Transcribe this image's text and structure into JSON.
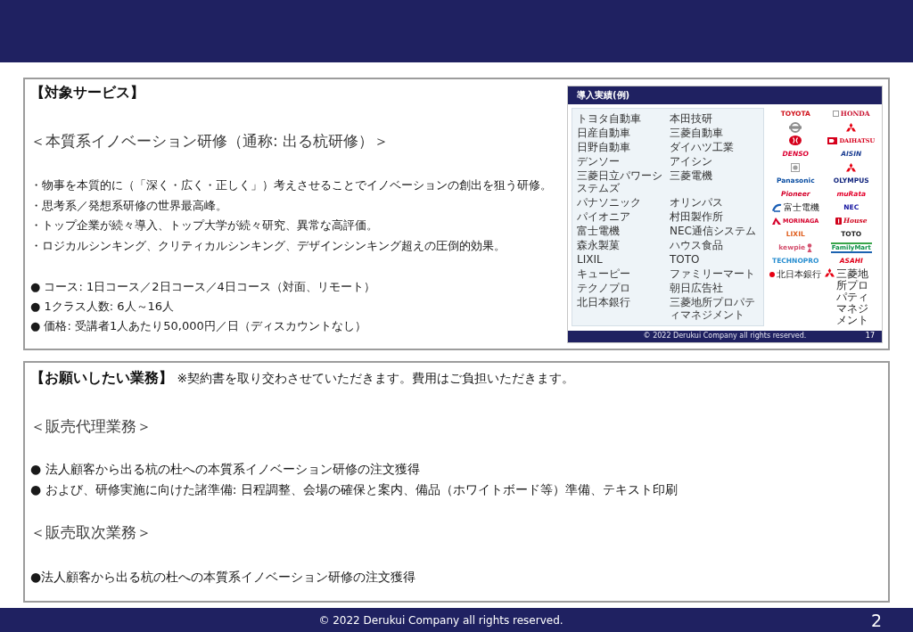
{
  "service_section": {
    "title": "【対象サービス】",
    "subtitle": "＜本質系イノベーション研修（通称: 出る杭研修）＞",
    "points": [
      "・物事を本質的に（「深く・広く・正しく」）考えさせることでイノベーションの創出を狙う研修。",
      "・思考系／発想系研修の世界最高峰。",
      "・トップ企業が続々導入、トップ大学が続々研究、異常な高評価。",
      "・ロジカルシンキング、クリティカルシンキング、デザインシンキング超えの圧倒的効果。"
    ],
    "details": [
      "● コース: 1日コース／2日コース／4日コース（対面、リモート）",
      "● 1クラス人数: 6人～16人",
      "● 価格: 受講者1人あたり50,000円／日（ディスカウントなし）"
    ],
    "slide": {
      "title": "導入実績(例)",
      "companies": [
        [
          "トヨタ自動車",
          "本田技研"
        ],
        [
          "日産自動車",
          "三菱自動車"
        ],
        [
          "日野自動車",
          "ダイハツ工業"
        ],
        [
          "デンソー",
          "アイシン"
        ],
        [
          "三菱日立パワーシステムズ",
          "三菱電機"
        ],
        [
          "パナソニック",
          "オリンパス"
        ],
        [
          "パイオニア",
          "村田製作所"
        ],
        [
          "富士電機",
          "NEC通信システム"
        ],
        [
          "森永製菓",
          "ハウス食品"
        ],
        [
          "LIXIL",
          "TOTO"
        ],
        [
          "キューピー",
          "ファミリーマート"
        ],
        [
          "テクノプロ",
          "朝日広告社"
        ],
        [
          "北日本銀行",
          "三菱地所プロパティマネジメント"
        ]
      ],
      "logos": [
        {
          "kind": "bold",
          "text": "TOYOTA",
          "color": "#d0121b"
        },
        {
          "kind": "serif",
          "text": "HONDA",
          "color": "#c8102e"
        },
        {
          "kind": "ring",
          "color": "#8c8c8c"
        },
        {
          "kind": "diamonds",
          "color": "#e60012"
        },
        {
          "kind": "oval",
          "color": "#d6001c"
        },
        {
          "kind": "tag",
          "text": "DAIHATSU",
          "color": "#d6001c"
        },
        {
          "kind": "italic",
          "text": "DENSO",
          "color": "#dc0032"
        },
        {
          "kind": "italic",
          "text": "AISIN",
          "color": "#1d3f93"
        },
        {
          "kind": "badge",
          "color": "#a0a0a0"
        },
        {
          "kind": "diamonds",
          "color": "#e60012"
        },
        {
          "kind": "bold",
          "text": "Panasonic",
          "color": "#0a4ea2"
        },
        {
          "kind": "bold",
          "text": "OLYMPUS",
          "color": "#0b1f7a"
        },
        {
          "kind": "italic",
          "text": "Pioneer",
          "color": "#d4002a"
        },
        {
          "kind": "italic",
          "text": "muRata",
          "color": "#e4002b"
        },
        {
          "kind": "swoosh",
          "text": "富士電機",
          "color": "#1b5fb5"
        },
        {
          "kind": "bold",
          "text": "NEC",
          "color": "#1414a0"
        },
        {
          "kind": "wing",
          "text": "MORINAGA",
          "color": "#d5002b"
        },
        {
          "kind": "script",
          "text": "House",
          "color": "#d0021b"
        },
        {
          "kind": "bold",
          "text": "LIXIL",
          "color": "#e06020"
        },
        {
          "kind": "bold",
          "text": "TOTO",
          "color": "#222222"
        },
        {
          "kind": "figure",
          "text": "kewpie",
          "color": "#d4506e"
        },
        {
          "kind": "stripes",
          "text": "FamilyMart",
          "color": "#0e9148"
        },
        {
          "kind": "bold",
          "text": "TECHNOPRO",
          "color": "#2a8fd0"
        },
        {
          "kind": "italic",
          "text": "ASAHI",
          "color": "#e0001a"
        },
        {
          "kind": "dot",
          "text": "北日本銀行",
          "color": "#e60012"
        },
        {
          "kind": "diamonds",
          "text": "三菱地所プロパティマネジメント",
          "color": "#e60012"
        }
      ],
      "footer": "© 2022 Derukui Company all rights reserved.",
      "page": "17"
    }
  },
  "request_section": {
    "title": "**【お願いしたい業務】** ※契約書を取り交わさせていただきます。費用はご負担いただきます。",
    "groups": [
      {
        "heading": "＜販売代理業務＞",
        "items": [
          "● 法人顧客から出る杭の杜への本質系イノベーション研修の注文獲得",
          "● および、研修実施に向けた諸準備: 日程調整、会場の確保と案内、備品（ホワイトボード等）準備、テキスト印刷"
        ]
      },
      {
        "heading": "＜販売取次業務＞",
        "items": [
          "●法人顧客から出る杭の杜への本質系イノベーション研修の注文獲得"
        ]
      }
    ]
  },
  "footer": {
    "copyright": "© 2022 Derukui Company all rights reserved.",
    "page": "2"
  }
}
